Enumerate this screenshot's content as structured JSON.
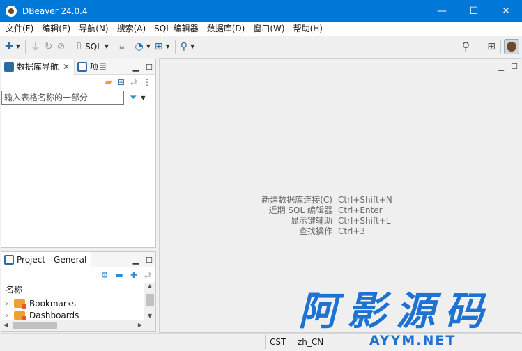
{
  "window": {
    "title": "DBeaver 24.0.4",
    "minimize": "—",
    "maximize": "☐",
    "close": "✕"
  },
  "menu": [
    "文件(F)",
    "编辑(E)",
    "导航(N)",
    "搜索(A)",
    "SQL 编辑器",
    "数据库(D)",
    "窗口(W)",
    "帮助(H)"
  ],
  "toolbar": {
    "sql_label": "SQL"
  },
  "nav_panel": {
    "tabs": [
      {
        "label": "数据库导航"
      },
      {
        "label": "项目"
      }
    ],
    "filter_placeholder": "输入表格名称的一部分"
  },
  "editor": {
    "hints": [
      {
        "label": "新建数据库连接(C)",
        "key": "Ctrl+Shift+N"
      },
      {
        "label": "近期 SQL 编辑器",
        "key": "Ctrl+Enter"
      },
      {
        "label": "显示键辅助",
        "key": "Ctrl+Shift+L"
      },
      {
        "label": "查找操作",
        "key": "Ctrl+3"
      }
    ]
  },
  "project_panel": {
    "tab_label": "Project - General",
    "column_header": "名称",
    "items": [
      {
        "label": "Bookmarks"
      },
      {
        "label": "Dashboards"
      }
    ]
  },
  "status": {
    "timezone": "CST",
    "locale": "zh_CN"
  },
  "watermark": {
    "cn": "阿影源码",
    "en": "AYYM.NET"
  },
  "colors": {
    "titlebar": "#0078d7",
    "accent": "#2d6ca2",
    "watermark": "#1e73d2"
  }
}
